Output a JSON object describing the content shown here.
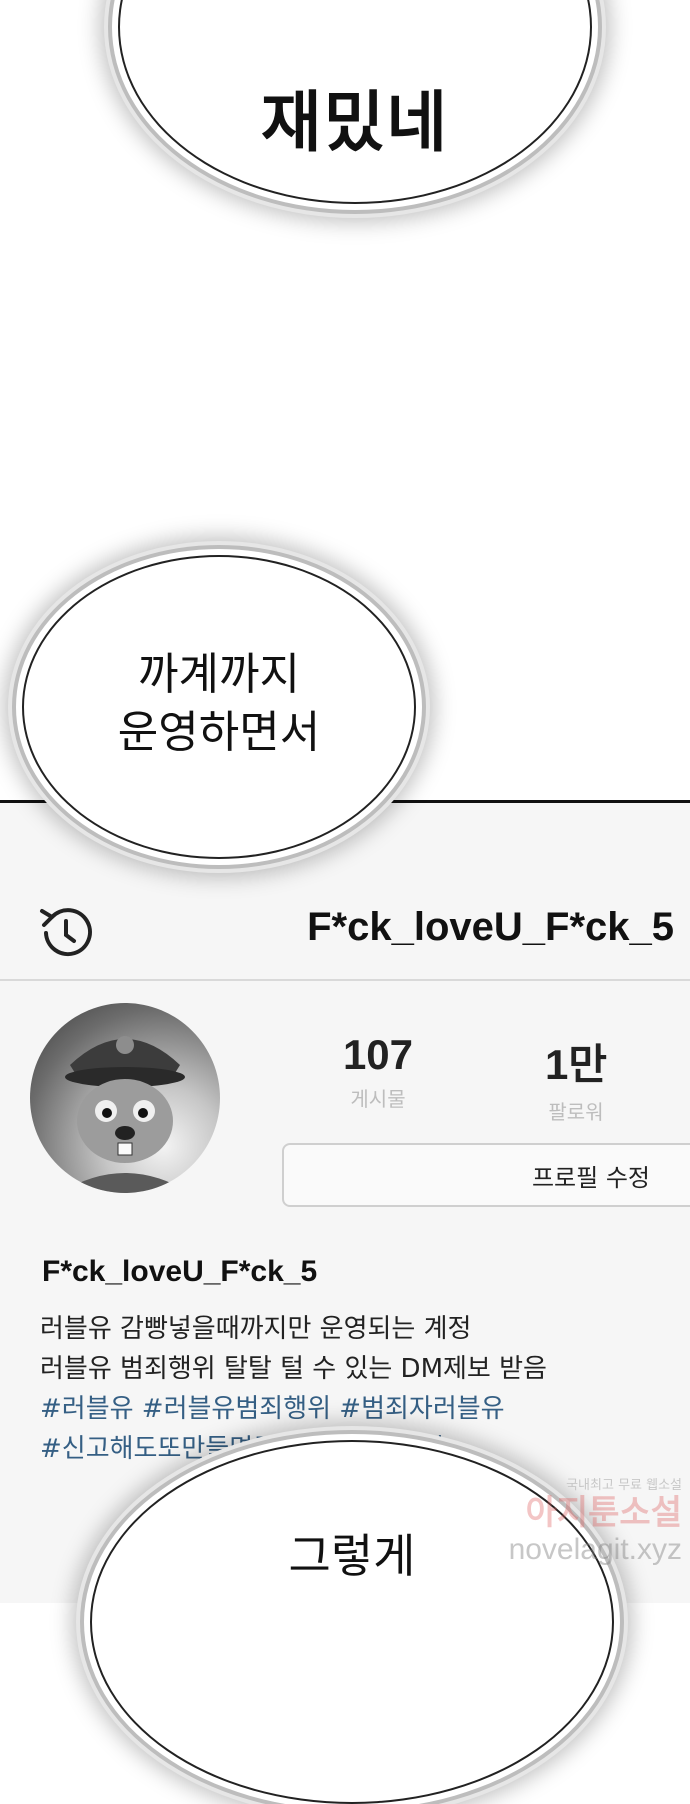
{
  "bubbles": {
    "top": "재밌네",
    "middle_line_1": "까계까지",
    "middle_line_2": "운영하면서",
    "bottom": "그렇게"
  },
  "profile": {
    "username_header": "F*ck_loveU_F*ck_5",
    "stats": {
      "posts_value": "107",
      "posts_label": "게시물",
      "followers_value": "1만",
      "followers_label": "팔로워"
    },
    "edit_button_label": "프로필 수정",
    "bio_name": "F*ck_loveU_F*ck_5",
    "bio_line_1": "러블유 감빵넣을때까지만 운영되는 계정",
    "bio_line_2": "러블유 범죄행위 탈탈 털 수 있는 DM제보 받음",
    "hashtags_line_1": "#러블유 #러블유범죄행위 #범죄자러블유",
    "hashtags_line_2": "#신고해도또만들면됨 #계폭만4번째"
  },
  "watermark": {
    "line_1": "국내최고 무료 웹소설",
    "line_2": "아지툰소설",
    "line_3": "novelagit.xyz"
  },
  "icons": {
    "history": "history-icon",
    "avatar": "avatar-image"
  },
  "colors": {
    "hashtag": "#355f84",
    "panel_background": "#f6f6f6",
    "muted_label": "#bdbdbd"
  }
}
